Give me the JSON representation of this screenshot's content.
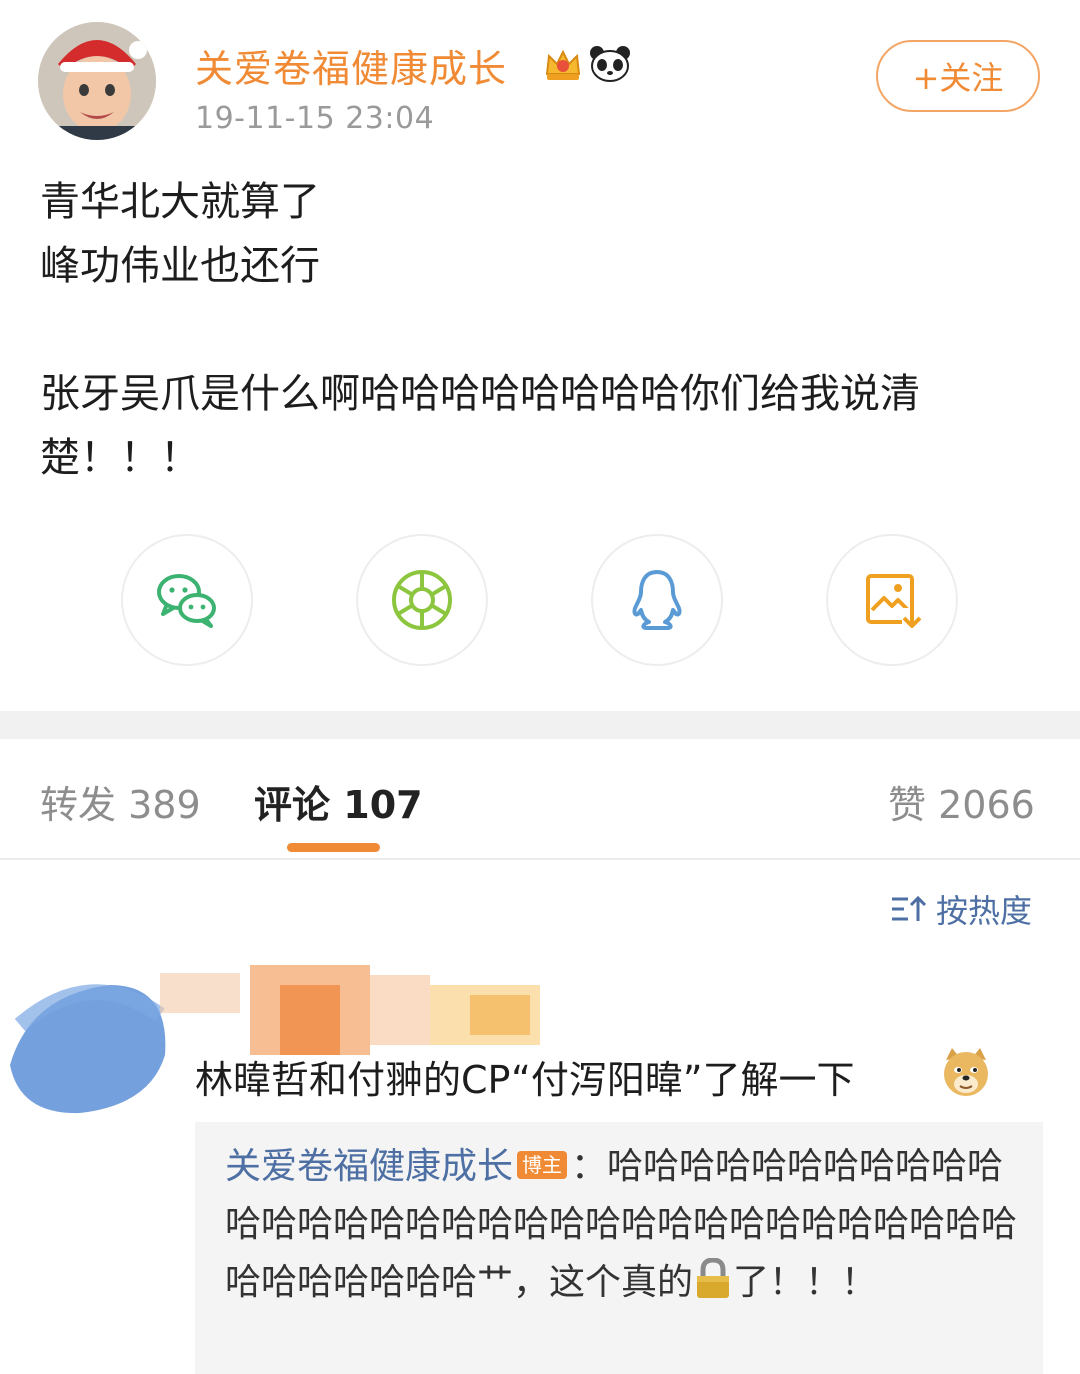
{
  "post": {
    "author": "关爱卷福健康成长",
    "timestamp": "19-11-15 23:04",
    "follow_label": "+关注",
    "lines": [
      "青华北大就算了",
      "峰功伟业也还行",
      "张牙吴爪是什么啊哈哈哈哈哈哈哈哈你们给我说清",
      "楚！！！"
    ]
  },
  "share": {
    "items": [
      "wechat-icon",
      "moments-icon",
      "qq-icon",
      "save-image-icon"
    ]
  },
  "tabs": {
    "repost_label": "转发",
    "repost_count": "389",
    "comment_label": "评论",
    "comment_count": "107",
    "like_label": "赞",
    "like_count": "2066"
  },
  "sort": {
    "label": "按热度"
  },
  "comment": {
    "text": "林暐哲和付翀的CP“付泻阳暐”了解一下",
    "reply": {
      "author": "关爱卷福健康成长",
      "owner_badge": "博主",
      "text_before_icon": "：哈哈哈哈哈哈哈哈哈哈哈哈哈哈哈哈哈哈哈哈哈哈哈哈哈哈哈哈哈哈哈哈哈哈哈哈哈哈哈哈艹，这个真的",
      "text_after_icon": "了！！！"
    }
  },
  "colors": {
    "accent": "#f08a34",
    "link": "#4d6fa3",
    "wechat": "#3cb371",
    "moments": "#8cc63f",
    "qq": "#5b9bd5",
    "save": "#f0a020"
  }
}
